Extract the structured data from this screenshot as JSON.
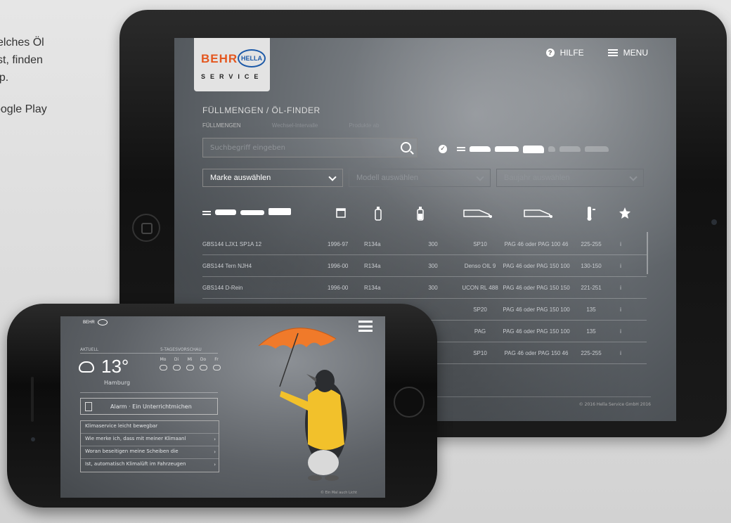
{
  "promo": {
    "line1": "elches Öl",
    "line2": "st, finden",
    "line3": "pp.",
    "line4": "oogle Play"
  },
  "tablet": {
    "logo": {
      "brand1": "BEHR",
      "brand2": "HELLA",
      "sub": "SERVICE"
    },
    "nav": {
      "help": "HILFE",
      "menu": "MENU"
    },
    "breadcrumb": "FÜLLMENGEN / ÖL-FINDER",
    "subtabs": [
      "FÜLLMENGEN",
      "Wechsel-Intervalle",
      "Produkte ab"
    ],
    "search": {
      "placeholder": "Suchbegriff eingeben"
    },
    "selects": [
      {
        "label": "Marke auswählen",
        "active": true
      },
      {
        "label": "Modell auswählen",
        "active": false
      },
      {
        "label": "Baujahr auswählen",
        "active": false
      }
    ],
    "rows": [
      {
        "model": "GBS144 LJX1 SP1A 12",
        "year": "1996-97",
        "ref": "R134a",
        "amount": "300",
        "oil": "SP10",
        "spec": "PAG 46 oder PAG 100 46",
        "fill": "225-255",
        "mark": "i"
      },
      {
        "model": "GBS144 Tern NJH4",
        "year": "1996-00",
        "ref": "R134a",
        "amount": "300",
        "oil": "Denso OIL 9",
        "spec": "PAG 46 oder PAG 150 100",
        "fill": "130-150",
        "mark": "i"
      },
      {
        "model": "GBS144 D-Rein",
        "year": "1996-00",
        "ref": "R134a",
        "amount": "300",
        "oil": "UCON RL 488",
        "spec": "PAG 46 oder PAG 150 150",
        "fill": "221-251",
        "mark": "i"
      },
      {
        "model": "",
        "year": "",
        "ref": "",
        "amount": "",
        "oil": "SP20",
        "spec": "PAG 46 oder PAG 150 100",
        "fill": "135",
        "mark": "i"
      },
      {
        "model": "",
        "year": "",
        "ref": "",
        "amount": "",
        "oil": "PAG",
        "spec": "PAG 46 oder PAG 150 100",
        "fill": "135",
        "mark": "i"
      },
      {
        "model": "",
        "year": "",
        "ref": "",
        "amount": "",
        "oil": "SP10",
        "spec": "PAG 46 oder PAG 150 46",
        "fill": "225-255",
        "mark": "i"
      }
    ],
    "footer": "© 2016 Hella Service GmbH 2016"
  },
  "phone": {
    "logo": "BEHR",
    "label_now": "AKTUELL",
    "label_forecast": "5-TAGESVORSCHAU",
    "temperature": "13°",
    "city": "Hamburg",
    "forecast_days": [
      "Mo",
      "Di",
      "Mi",
      "Do",
      "Fr"
    ],
    "alarm": "Alarm · Ein Unterrichtmichen",
    "list": [
      "Klimaservice leicht bewegbar",
      "Wie merke ich, dass mit meiner Klimaanl",
      "Woran beseitigen meine Scheiben die",
      "Ist, automatisch Klimalüft im Fahrzeugen"
    ],
    "footer": "© Ein Mal auch Licht"
  }
}
